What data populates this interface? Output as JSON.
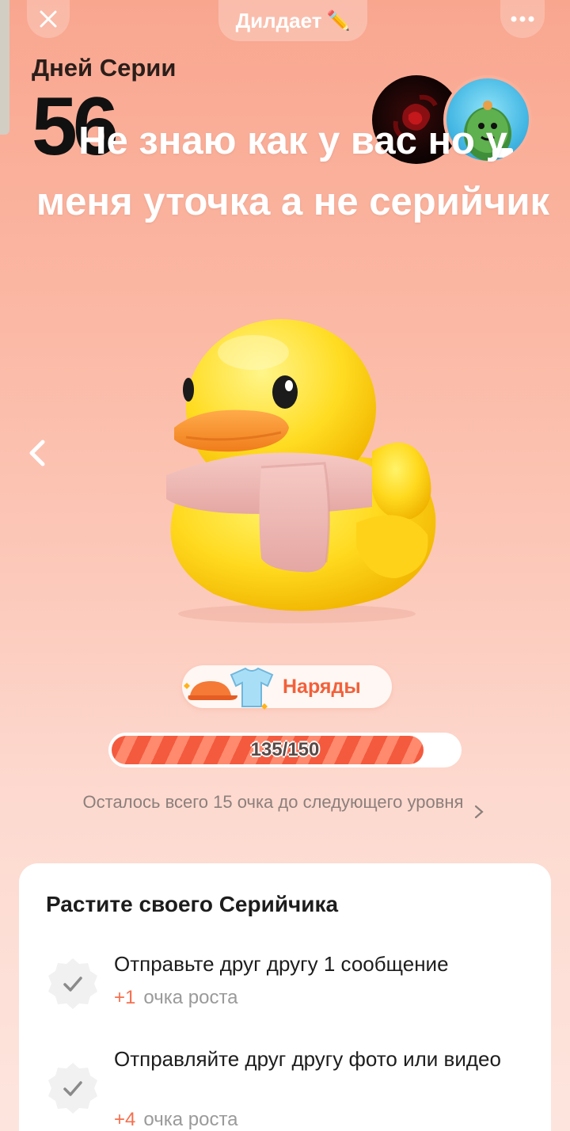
{
  "header": {
    "title": "Дилдает",
    "title_emoji": "✏️"
  },
  "streak": {
    "label": "Дней Серии",
    "days": "56"
  },
  "caption": "Не знаю как у вас но у меня уточка а не серийчик",
  "outfits": {
    "label": "Наряды"
  },
  "progress": {
    "current": 135,
    "max": 150,
    "text": "135/150"
  },
  "remaining_text": "Осталось всего 15 очка до следующего уровня",
  "card": {
    "title": "Растите своего Серийчика",
    "tasks": [
      {
        "text": "Отправьте друг другу 1 сообщение",
        "points": "+1",
        "points_label": "очка роста"
      },
      {
        "text": "Отправляйте друг другу фото или видео",
        "points": "+4",
        "points_label": "очка роста"
      }
    ]
  },
  "colors": {
    "accent": "#f45a3e",
    "background_top": "#f9a68f",
    "background_bottom": "#fde5de"
  }
}
